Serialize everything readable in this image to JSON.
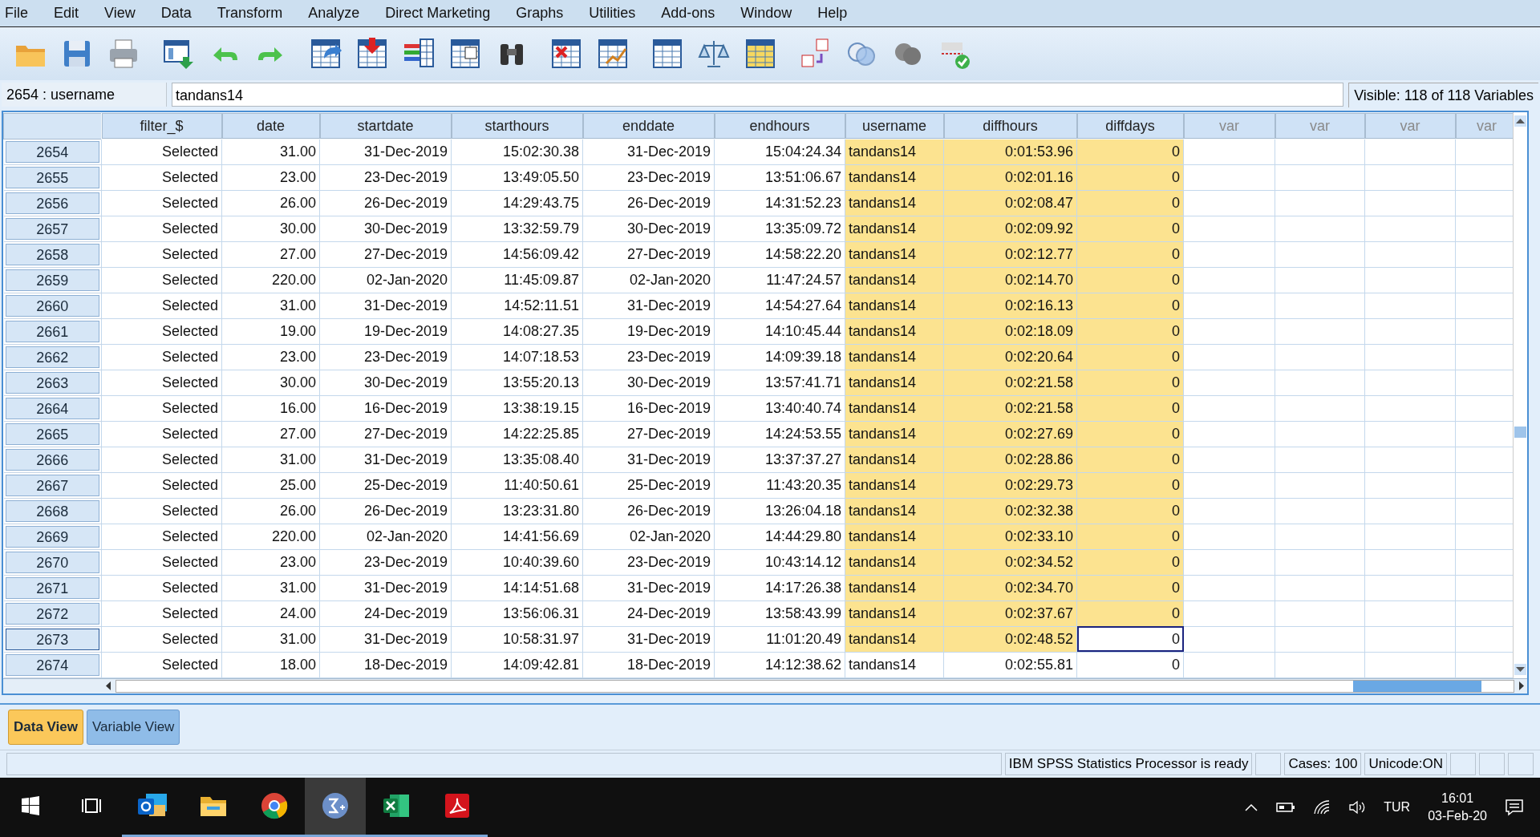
{
  "menu": [
    "File",
    "Edit",
    "View",
    "Data",
    "Transform",
    "Analyze",
    "Direct Marketing",
    "Graphs",
    "Utilities",
    "Add-ons",
    "Window",
    "Help"
  ],
  "cell_editor": {
    "reference": "2654 : username",
    "value": "tandans14",
    "visible_variables": "Visible: 118 of 118 Variables"
  },
  "table": {
    "columns": [
      {
        "label": "filter_$",
        "kind": "numeric"
      },
      {
        "label": "date",
        "kind": "numeric"
      },
      {
        "label": "startdate",
        "kind": "numeric"
      },
      {
        "label": "starthours",
        "kind": "numeric"
      },
      {
        "label": "enddate",
        "kind": "numeric"
      },
      {
        "label": "endhours",
        "kind": "numeric"
      },
      {
        "label": "username",
        "kind": "string"
      },
      {
        "label": "diffhours",
        "kind": "numeric"
      },
      {
        "label": "diffdays",
        "kind": "numeric"
      },
      {
        "label": "var",
        "kind": "empty"
      },
      {
        "label": "var",
        "kind": "empty"
      },
      {
        "label": "var",
        "kind": "empty"
      },
      {
        "label": "var",
        "kind": "empty"
      }
    ],
    "rows": [
      {
        "case": "2654",
        "focused": false,
        "cells": [
          {
            "text": "Selected",
            "selected": false
          },
          {
            "text": "31.00",
            "selected": false
          },
          {
            "text": "31-Dec-2019",
            "selected": false
          },
          {
            "text": "15:02:30.38",
            "selected": false
          },
          {
            "text": "31-Dec-2019",
            "selected": false
          },
          {
            "text": "15:04:24.34",
            "selected": false
          },
          {
            "text": "tandans14",
            "selected": true
          },
          {
            "text": "0:01:53.96",
            "selected": true
          },
          {
            "text": "0",
            "selected": true
          }
        ]
      },
      {
        "case": "2655",
        "focused": false,
        "cells": [
          {
            "text": "Selected",
            "selected": false
          },
          {
            "text": "23.00",
            "selected": false
          },
          {
            "text": "23-Dec-2019",
            "selected": false
          },
          {
            "text": "13:49:05.50",
            "selected": false
          },
          {
            "text": "23-Dec-2019",
            "selected": false
          },
          {
            "text": "13:51:06.67",
            "selected": false
          },
          {
            "text": "tandans14",
            "selected": true
          },
          {
            "text": "0:02:01.16",
            "selected": true
          },
          {
            "text": "0",
            "selected": true
          }
        ]
      },
      {
        "case": "2656",
        "focused": false,
        "cells": [
          {
            "text": "Selected",
            "selected": false
          },
          {
            "text": "26.00",
            "selected": false
          },
          {
            "text": "26-Dec-2019",
            "selected": false
          },
          {
            "text": "14:29:43.75",
            "selected": false
          },
          {
            "text": "26-Dec-2019",
            "selected": false
          },
          {
            "text": "14:31:52.23",
            "selected": false
          },
          {
            "text": "tandans14",
            "selected": true
          },
          {
            "text": "0:02:08.47",
            "selected": true
          },
          {
            "text": "0",
            "selected": true
          }
        ]
      },
      {
        "case": "2657",
        "focused": false,
        "cells": [
          {
            "text": "Selected",
            "selected": false
          },
          {
            "text": "30.00",
            "selected": false
          },
          {
            "text": "30-Dec-2019",
            "selected": false
          },
          {
            "text": "13:32:59.79",
            "selected": false
          },
          {
            "text": "30-Dec-2019",
            "selected": false
          },
          {
            "text": "13:35:09.72",
            "selected": false
          },
          {
            "text": "tandans14",
            "selected": true
          },
          {
            "text": "0:02:09.92",
            "selected": true
          },
          {
            "text": "0",
            "selected": true
          }
        ]
      },
      {
        "case": "2658",
        "focused": false,
        "cells": [
          {
            "text": "Selected",
            "selected": false
          },
          {
            "text": "27.00",
            "selected": false
          },
          {
            "text": "27-Dec-2019",
            "selected": false
          },
          {
            "text": "14:56:09.42",
            "selected": false
          },
          {
            "text": "27-Dec-2019",
            "selected": false
          },
          {
            "text": "14:58:22.20",
            "selected": false
          },
          {
            "text": "tandans14",
            "selected": true
          },
          {
            "text": "0:02:12.77",
            "selected": true
          },
          {
            "text": "0",
            "selected": true
          }
        ]
      },
      {
        "case": "2659",
        "focused": false,
        "cells": [
          {
            "text": "Selected",
            "selected": false
          },
          {
            "text": "220.00",
            "selected": false
          },
          {
            "text": "02-Jan-2020",
            "selected": false
          },
          {
            "text": "11:45:09.87",
            "selected": false
          },
          {
            "text": "02-Jan-2020",
            "selected": false
          },
          {
            "text": "11:47:24.57",
            "selected": false
          },
          {
            "text": "tandans14",
            "selected": true
          },
          {
            "text": "0:02:14.70",
            "selected": true
          },
          {
            "text": "0",
            "selected": true
          }
        ]
      },
      {
        "case": "2660",
        "focused": false,
        "cells": [
          {
            "text": "Selected",
            "selected": false
          },
          {
            "text": "31.00",
            "selected": false
          },
          {
            "text": "31-Dec-2019",
            "selected": false
          },
          {
            "text": "14:52:11.51",
            "selected": false
          },
          {
            "text": "31-Dec-2019",
            "selected": false
          },
          {
            "text": "14:54:27.64",
            "selected": false
          },
          {
            "text": "tandans14",
            "selected": true
          },
          {
            "text": "0:02:16.13",
            "selected": true
          },
          {
            "text": "0",
            "selected": true
          }
        ]
      },
      {
        "case": "2661",
        "focused": false,
        "cells": [
          {
            "text": "Selected",
            "selected": false
          },
          {
            "text": "19.00",
            "selected": false
          },
          {
            "text": "19-Dec-2019",
            "selected": false
          },
          {
            "text": "14:08:27.35",
            "selected": false
          },
          {
            "text": "19-Dec-2019",
            "selected": false
          },
          {
            "text": "14:10:45.44",
            "selected": false
          },
          {
            "text": "tandans14",
            "selected": true
          },
          {
            "text": "0:02:18.09",
            "selected": true
          },
          {
            "text": "0",
            "selected": true
          }
        ]
      },
      {
        "case": "2662",
        "focused": false,
        "cells": [
          {
            "text": "Selected",
            "selected": false
          },
          {
            "text": "23.00",
            "selected": false
          },
          {
            "text": "23-Dec-2019",
            "selected": false
          },
          {
            "text": "14:07:18.53",
            "selected": false
          },
          {
            "text": "23-Dec-2019",
            "selected": false
          },
          {
            "text": "14:09:39.18",
            "selected": false
          },
          {
            "text": "tandans14",
            "selected": true
          },
          {
            "text": "0:02:20.64",
            "selected": true
          },
          {
            "text": "0",
            "selected": true
          }
        ]
      },
      {
        "case": "2663",
        "focused": false,
        "cells": [
          {
            "text": "Selected",
            "selected": false
          },
          {
            "text": "30.00",
            "selected": false
          },
          {
            "text": "30-Dec-2019",
            "selected": false
          },
          {
            "text": "13:55:20.13",
            "selected": false
          },
          {
            "text": "30-Dec-2019",
            "selected": false
          },
          {
            "text": "13:57:41.71",
            "selected": false
          },
          {
            "text": "tandans14",
            "selected": true
          },
          {
            "text": "0:02:21.58",
            "selected": true
          },
          {
            "text": "0",
            "selected": true
          }
        ]
      },
      {
        "case": "2664",
        "focused": false,
        "cells": [
          {
            "text": "Selected",
            "selected": false
          },
          {
            "text": "16.00",
            "selected": false
          },
          {
            "text": "16-Dec-2019",
            "selected": false
          },
          {
            "text": "13:38:19.15",
            "selected": false
          },
          {
            "text": "16-Dec-2019",
            "selected": false
          },
          {
            "text": "13:40:40.74",
            "selected": false
          },
          {
            "text": "tandans14",
            "selected": true
          },
          {
            "text": "0:02:21.58",
            "selected": true
          },
          {
            "text": "0",
            "selected": true
          }
        ]
      },
      {
        "case": "2665",
        "focused": false,
        "cells": [
          {
            "text": "Selected",
            "selected": false
          },
          {
            "text": "27.00",
            "selected": false
          },
          {
            "text": "27-Dec-2019",
            "selected": false
          },
          {
            "text": "14:22:25.85",
            "selected": false
          },
          {
            "text": "27-Dec-2019",
            "selected": false
          },
          {
            "text": "14:24:53.55",
            "selected": false
          },
          {
            "text": "tandans14",
            "selected": true
          },
          {
            "text": "0:02:27.69",
            "selected": true
          },
          {
            "text": "0",
            "selected": true
          }
        ]
      },
      {
        "case": "2666",
        "focused": false,
        "cells": [
          {
            "text": "Selected",
            "selected": false
          },
          {
            "text": "31.00",
            "selected": false
          },
          {
            "text": "31-Dec-2019",
            "selected": false
          },
          {
            "text": "13:35:08.40",
            "selected": false
          },
          {
            "text": "31-Dec-2019",
            "selected": false
          },
          {
            "text": "13:37:37.27",
            "selected": false
          },
          {
            "text": "tandans14",
            "selected": true
          },
          {
            "text": "0:02:28.86",
            "selected": true
          },
          {
            "text": "0",
            "selected": true
          }
        ]
      },
      {
        "case": "2667",
        "focused": false,
        "cells": [
          {
            "text": "Selected",
            "selected": false
          },
          {
            "text": "25.00",
            "selected": false
          },
          {
            "text": "25-Dec-2019",
            "selected": false
          },
          {
            "text": "11:40:50.61",
            "selected": false
          },
          {
            "text": "25-Dec-2019",
            "selected": false
          },
          {
            "text": "11:43:20.35",
            "selected": false
          },
          {
            "text": "tandans14",
            "selected": true
          },
          {
            "text": "0:02:29.73",
            "selected": true
          },
          {
            "text": "0",
            "selected": true
          }
        ]
      },
      {
        "case": "2668",
        "focused": false,
        "cells": [
          {
            "text": "Selected",
            "selected": false
          },
          {
            "text": "26.00",
            "selected": false
          },
          {
            "text": "26-Dec-2019",
            "selected": false
          },
          {
            "text": "13:23:31.80",
            "selected": false
          },
          {
            "text": "26-Dec-2019",
            "selected": false
          },
          {
            "text": "13:26:04.18",
            "selected": false
          },
          {
            "text": "tandans14",
            "selected": true
          },
          {
            "text": "0:02:32.38",
            "selected": true
          },
          {
            "text": "0",
            "selected": true
          }
        ]
      },
      {
        "case": "2669",
        "focused": false,
        "cells": [
          {
            "text": "Selected",
            "selected": false
          },
          {
            "text": "220.00",
            "selected": false
          },
          {
            "text": "02-Jan-2020",
            "selected": false
          },
          {
            "text": "14:41:56.69",
            "selected": false
          },
          {
            "text": "02-Jan-2020",
            "selected": false
          },
          {
            "text": "14:44:29.80",
            "selected": false
          },
          {
            "text": "tandans14",
            "selected": true
          },
          {
            "text": "0:02:33.10",
            "selected": true
          },
          {
            "text": "0",
            "selected": true
          }
        ]
      },
      {
        "case": "2670",
        "focused": false,
        "cells": [
          {
            "text": "Selected",
            "selected": false
          },
          {
            "text": "23.00",
            "selected": false
          },
          {
            "text": "23-Dec-2019",
            "selected": false
          },
          {
            "text": "10:40:39.60",
            "selected": false
          },
          {
            "text": "23-Dec-2019",
            "selected": false
          },
          {
            "text": "10:43:14.12",
            "selected": false
          },
          {
            "text": "tandans14",
            "selected": true
          },
          {
            "text": "0:02:34.52",
            "selected": true
          },
          {
            "text": "0",
            "selected": true
          }
        ]
      },
      {
        "case": "2671",
        "focused": false,
        "cells": [
          {
            "text": "Selected",
            "selected": false
          },
          {
            "text": "31.00",
            "selected": false
          },
          {
            "text": "31-Dec-2019",
            "selected": false
          },
          {
            "text": "14:14:51.68",
            "selected": false
          },
          {
            "text": "31-Dec-2019",
            "selected": false
          },
          {
            "text": "14:17:26.38",
            "selected": false
          },
          {
            "text": "tandans14",
            "selected": true
          },
          {
            "text": "0:02:34.70",
            "selected": true
          },
          {
            "text": "0",
            "selected": true
          }
        ]
      },
      {
        "case": "2672",
        "focused": false,
        "cells": [
          {
            "text": "Selected",
            "selected": false
          },
          {
            "text": "24.00",
            "selected": false
          },
          {
            "text": "24-Dec-2019",
            "selected": false
          },
          {
            "text": "13:56:06.31",
            "selected": false
          },
          {
            "text": "24-Dec-2019",
            "selected": false
          },
          {
            "text": "13:58:43.99",
            "selected": false
          },
          {
            "text": "tandans14",
            "selected": true
          },
          {
            "text": "0:02:37.67",
            "selected": true
          },
          {
            "text": "0",
            "selected": true
          }
        ]
      },
      {
        "case": "2673",
        "focused": true,
        "cells": [
          {
            "text": "Selected",
            "selected": false
          },
          {
            "text": "31.00",
            "selected": false
          },
          {
            "text": "31-Dec-2019",
            "selected": false
          },
          {
            "text": "10:58:31.97",
            "selected": false
          },
          {
            "text": "31-Dec-2019",
            "selected": false
          },
          {
            "text": "11:01:20.49",
            "selected": false
          },
          {
            "text": "tandans14",
            "selected": true
          },
          {
            "text": "0:02:48.52",
            "selected": true
          },
          {
            "text": "0",
            "selected": false
          }
        ]
      },
      {
        "case": "2674",
        "focused": false,
        "cells": [
          {
            "text": "Selected",
            "selected": false
          },
          {
            "text": "18.00",
            "selected": false
          },
          {
            "text": "18-Dec-2019",
            "selected": false
          },
          {
            "text": "14:09:42.81",
            "selected": false
          },
          {
            "text": "18-Dec-2019",
            "selected": false
          },
          {
            "text": "14:12:38.62",
            "selected": false
          },
          {
            "text": "tandans14",
            "selected": false
          },
          {
            "text": "0:02:55.81",
            "selected": false
          },
          {
            "text": "0",
            "selected": false
          }
        ]
      }
    ]
  },
  "view_tabs": [
    {
      "label": "Data View",
      "selected": true
    },
    {
      "label": "Variable View",
      "selected": false
    }
  ],
  "status_bar": {
    "message": "IBM SPSS Statistics Processor is ready",
    "cases": "Cases: 100",
    "unicode": "Unicode:ON"
  },
  "taskbar": {
    "language": "TUR",
    "time": "16:01",
    "date": "03-Feb-20"
  }
}
